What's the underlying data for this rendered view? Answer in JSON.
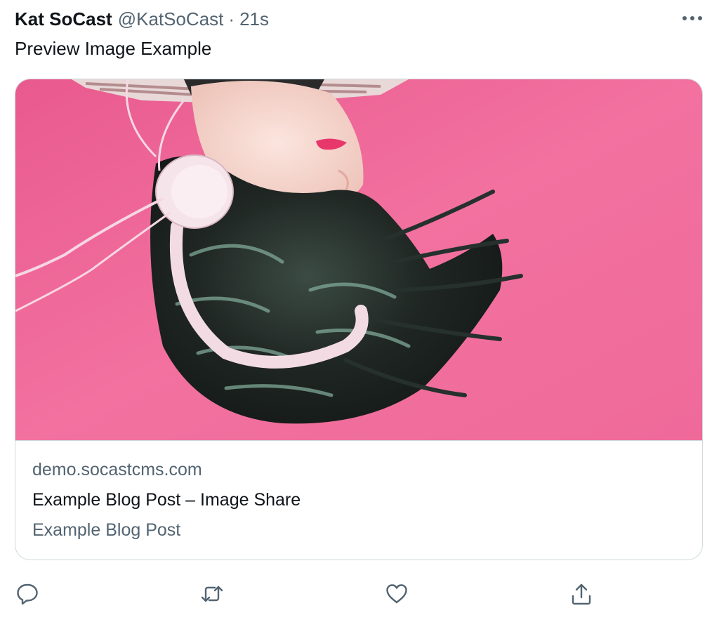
{
  "tweet": {
    "author_name": "Kat SoCast",
    "author_handle": "@KatSoCast",
    "separator": "·",
    "timestamp": "21s",
    "text": "Preview Image Example",
    "more_icon": "more-horizontal-icon"
  },
  "link_card": {
    "image_description_icon": "preview-photo",
    "domain": "demo.socastcms.com",
    "title": "Example Blog Post – Image Share",
    "description": "Example Blog Post"
  },
  "actions": {
    "reply_icon": "reply-icon",
    "retweet_icon": "retweet-icon",
    "like_icon": "like-icon",
    "share_icon": "share-icon"
  },
  "colors": {
    "text_primary": "#0f1419",
    "text_secondary": "#536471",
    "border": "#cfd9de",
    "image_background": "#f06b9b"
  }
}
